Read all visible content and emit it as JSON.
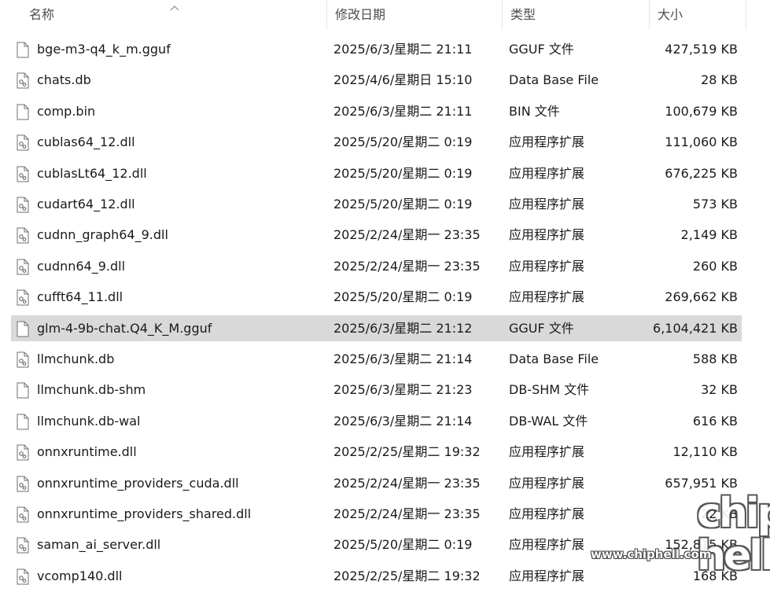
{
  "columns": {
    "name": "名称",
    "date": "修改日期",
    "type": "类型",
    "size": "大小"
  },
  "sort": {
    "column": "name",
    "icon": "sort-up-arrow-icon"
  },
  "files": [
    {
      "name": "bge-m3-q4_k_m.gguf",
      "date": "2025/6/3/星期二 21:11",
      "type": "GGUF 文件",
      "size": "427,519 KB",
      "icon": "blank-file-icon"
    },
    {
      "name": "chats.db",
      "date": "2025/4/6/星期日 15:10",
      "type": "Data Base File",
      "size": "28 KB",
      "icon": "settings-file-icon"
    },
    {
      "name": "comp.bin",
      "date": "2025/6/3/星期二 21:11",
      "type": "BIN 文件",
      "size": "100,679 KB",
      "icon": "blank-file-icon"
    },
    {
      "name": "cublas64_12.dll",
      "date": "2025/5/20/星期二 0:19",
      "type": "应用程序扩展",
      "size": "111,060 KB",
      "icon": "settings-file-icon"
    },
    {
      "name": "cublasLt64_12.dll",
      "date": "2025/5/20/星期二 0:19",
      "type": "应用程序扩展",
      "size": "676,225 KB",
      "icon": "settings-file-icon"
    },
    {
      "name": "cudart64_12.dll",
      "date": "2025/5/20/星期二 0:19",
      "type": "应用程序扩展",
      "size": "573 KB",
      "icon": "settings-file-icon"
    },
    {
      "name": "cudnn_graph64_9.dll",
      "date": "2025/2/24/星期一 23:35",
      "type": "应用程序扩展",
      "size": "2,149 KB",
      "icon": "settings-file-icon"
    },
    {
      "name": "cudnn64_9.dll",
      "date": "2025/2/24/星期一 23:35",
      "type": "应用程序扩展",
      "size": "260 KB",
      "icon": "settings-file-icon"
    },
    {
      "name": "cufft64_11.dll",
      "date": "2025/5/20/星期二 0:19",
      "type": "应用程序扩展",
      "size": "269,662 KB",
      "icon": "settings-file-icon"
    },
    {
      "name": "glm-4-9b-chat.Q4_K_M.gguf",
      "date": "2025/6/3/星期二 21:12",
      "type": "GGUF 文件",
      "size": "6,104,421 KB",
      "icon": "blank-file-icon",
      "selected": true
    },
    {
      "name": "llmchunk.db",
      "date": "2025/6/3/星期二 21:14",
      "type": "Data Base File",
      "size": "588 KB",
      "icon": "settings-file-icon"
    },
    {
      "name": "llmchunk.db-shm",
      "date": "2025/6/3/星期二 21:23",
      "type": "DB-SHM 文件",
      "size": "32 KB",
      "icon": "blank-file-icon"
    },
    {
      "name": "llmchunk.db-wal",
      "date": "2025/6/3/星期二 21:14",
      "type": "DB-WAL 文件",
      "size": "616 KB",
      "icon": "blank-file-icon"
    },
    {
      "name": "onnxruntime.dll",
      "date": "2025/2/25/星期二 19:32",
      "type": "应用程序扩展",
      "size": "12,110 KB",
      "icon": "settings-file-icon"
    },
    {
      "name": "onnxruntime_providers_cuda.dll",
      "date": "2025/2/24/星期一 23:35",
      "type": "应用程序扩展",
      "size": "657,951 KB",
      "icon": "settings-file-icon"
    },
    {
      "name": "onnxruntime_providers_shared.dll",
      "date": "2025/2/24/星期一 23:35",
      "type": "应用程序扩展",
      "size": "22 KB",
      "icon": "settings-file-icon"
    },
    {
      "name": "saman_ai_server.dll",
      "date": "2025/5/20/星期二 0:19",
      "type": "应用程序扩展",
      "size": "152,815 KB",
      "icon": "settings-file-icon"
    },
    {
      "name": "vcomp140.dll",
      "date": "2025/2/25/星期二 19:32",
      "type": "应用程序扩展",
      "size": "168 KB",
      "icon": "settings-file-icon"
    }
  ],
  "watermark": {
    "url": "www.chiphell.com",
    "logo_line1": "chip",
    "logo_line2": "hell"
  },
  "colors": {
    "selected_row": "#d9d9d9",
    "header_text": "#4d4d4d",
    "text": "#1a1a1a"
  }
}
